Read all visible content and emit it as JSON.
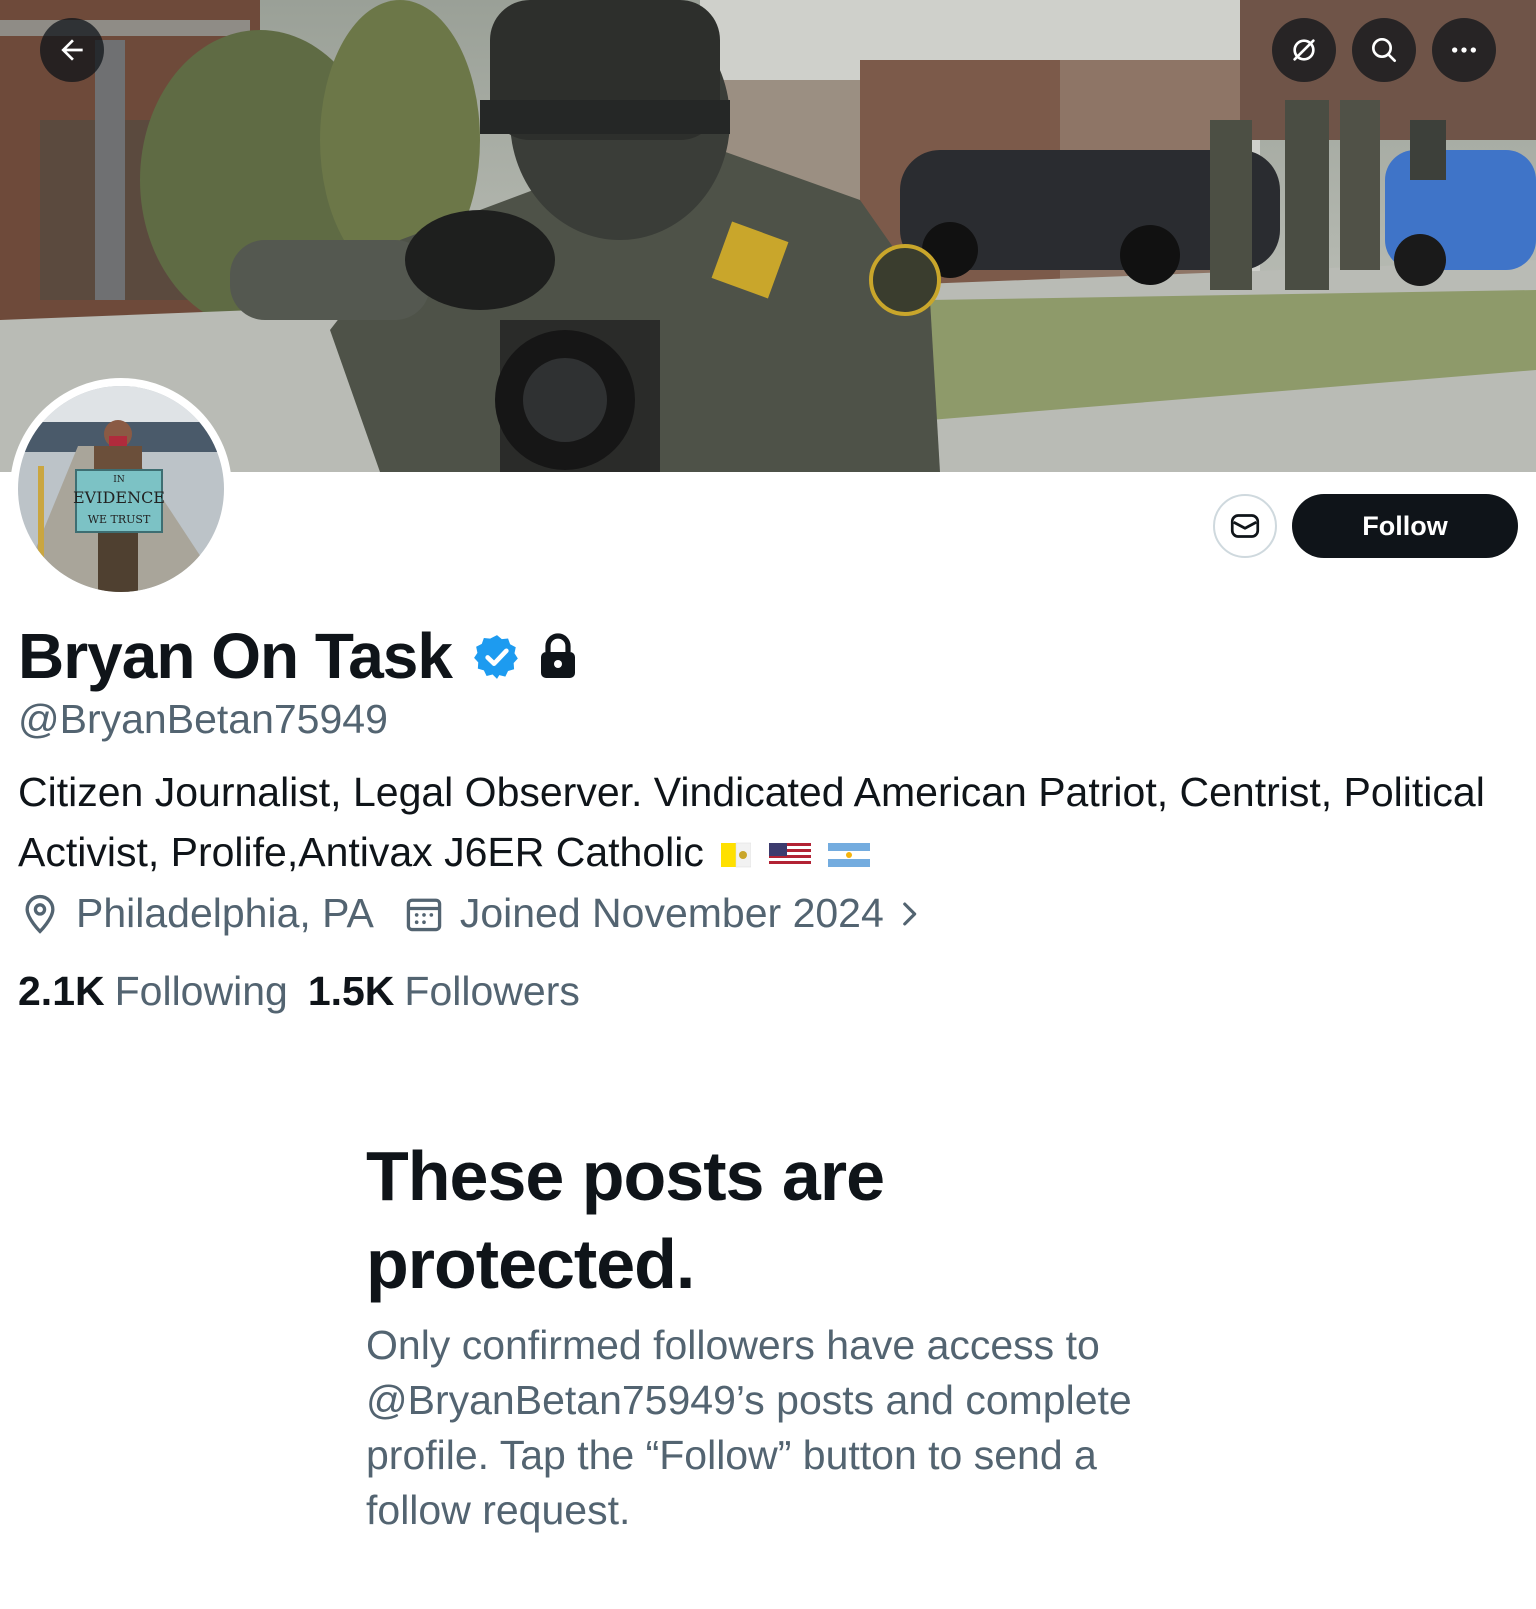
{
  "header": {
    "back_icon": "arrow-left-icon",
    "grok_icon": "grok-icon",
    "search_icon": "search-icon",
    "more_icon": "more-dots-icon"
  },
  "profile": {
    "display_name": "Bryan On Task",
    "handle": "@BryanBetan75949",
    "bio": "Citizen Journalist, Legal Observer. Vindicated American Patriot, Centrist, Political Activist, Prolife,Antivax J6ER Catholic",
    "bio_flags": [
      "vatican-flag",
      "us-flag",
      "argentina-flag"
    ],
    "location": "Philadelphia, PA",
    "joined": "Joined November 2024",
    "following_count": "2.1K",
    "following_label": "Following",
    "followers_count": "1.5K",
    "followers_label": "Followers",
    "avatar_sign": {
      "line1": "IN",
      "line2": "EVIDENCE",
      "line3": "WE TRUST"
    }
  },
  "actions": {
    "follow_label": "Follow",
    "message_icon": "envelope-icon"
  },
  "protected_notice": {
    "title": "These posts are protected.",
    "body": "Only confirmed followers have access to @BryanBetan75949’s posts and complete profile. Tap the “Follow” button to send a follow request."
  },
  "colors": {
    "text_primary": "#0f1419",
    "text_secondary": "#536471",
    "verified_blue": "#1d9bf0",
    "follow_bg": "#0f1419"
  }
}
